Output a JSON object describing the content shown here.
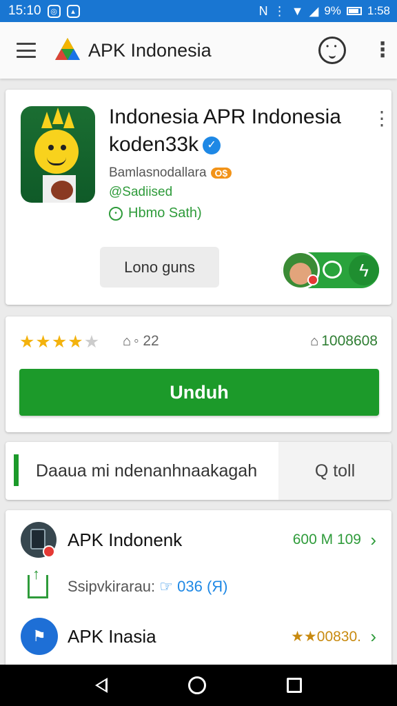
{
  "status_bar": {
    "time": "15:10",
    "battery": "9%",
    "clock_right": "1:58",
    "icons": [
      "chrome-icon",
      "image-icon",
      "nfc-icon",
      "vibrate-icon",
      "wifi-icon",
      "signal-icon",
      "battery-icon"
    ]
  },
  "app_bar": {
    "title": "APK Indonesia",
    "icons": [
      "menu-icon",
      "logo-icon",
      "face-icon",
      "more-vert-icon"
    ]
  },
  "app_card": {
    "name": "Indonesia APR Indonesia koden33k",
    "developer": "Bamlasnodallara",
    "developer_badge": "O$",
    "tag": "@Sadiised",
    "safety": "Hbmo Sath)",
    "secondary_button": "Lono guns",
    "icons": [
      "verified-icon",
      "more-vert-icon",
      "avatar",
      "chat-icon",
      "bolt-icon"
    ]
  },
  "rating_card": {
    "stars_filled": 4.5,
    "stars_total": 5,
    "likes": "◦ 22",
    "downloads": "1008608",
    "install_label": "Unduh"
  },
  "search": {
    "placeholder": "Daaua mi ndenanhnaakagah",
    "button_label": "Q toll"
  },
  "list": {
    "row1": {
      "title": "APK Indonenk",
      "meta": "600 M 109"
    },
    "row2": {
      "label": "Ssipvkirarau:",
      "value": "036 (Я)"
    },
    "row3": {
      "title": "APK Inasia",
      "rating": "00830."
    }
  },
  "colors": {
    "status_bar": "#1976d2",
    "accent_green": "#1c9a2a",
    "star": "#f3b20d",
    "link_blue": "#1e88e5"
  }
}
